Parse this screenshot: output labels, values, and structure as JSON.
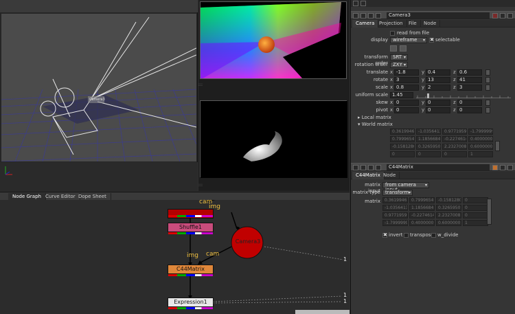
{
  "node_graph": {
    "tabs": [
      {
        "label": "Node Graph",
        "active": true
      },
      {
        "label": "Curve Editor",
        "active": false
      },
      {
        "label": "Dope Sheet",
        "active": false
      }
    ],
    "nodes": {
      "shuffle": "Shuffle1",
      "c44": "C44Matrix",
      "camera": "Camera3",
      "expression": "Expression1"
    },
    "labels": {
      "cam_top": "cam",
      "img_top": "img",
      "img": "img",
      "cam": "cam",
      "one_a": "1",
      "one_b": "1",
      "one_c": "1"
    }
  },
  "viewer3d": {
    "camera_label": "Camera3"
  },
  "camera_panel": {
    "node_name": "Camera3",
    "tabs": [
      {
        "label": "Camera",
        "active": true
      },
      {
        "label": "Projection",
        "active": false
      },
      {
        "label": "File",
        "active": false
      },
      {
        "label": "Node",
        "active": false
      }
    ],
    "read_from_file": "read from file",
    "display_label": "display",
    "display_value": "wireframe",
    "selectable": "selectable",
    "transform_order_label": "transform order",
    "transform_order": "SRT",
    "rotation_order_label": "rotation order",
    "rotation_order": "ZXY",
    "axes": {
      "x": "x",
      "y": "y",
      "z": "z"
    },
    "translate": {
      "label": "translate",
      "x": "-1.8",
      "y": "0.4",
      "z": "0.6"
    },
    "rotate": {
      "label": "rotate",
      "x": "3",
      "y": "13",
      "z": "41"
    },
    "scale": {
      "label": "scale",
      "x": "0.8",
      "y": "2",
      "z": "3"
    },
    "uniform_scale": {
      "label": "uniform scale",
      "value": "1.45"
    },
    "skew": {
      "label": "skew",
      "x": "0",
      "y": "0",
      "z": "0"
    },
    "pivot": {
      "label": "pivot",
      "x": "0",
      "y": "0",
      "z": "0"
    },
    "local_matrix": "Local matrix",
    "world_matrix": "World matrix",
    "world_matrix_values": [
      [
        "0.36199467",
        "-1.0356413",
        "0.97719599",
        "-1.7999999"
      ],
      [
        "0.79996546",
        "1.18566845",
        "-0.2274614",
        "0.40000001"
      ],
      [
        "-0.1581280",
        "0.32659507",
        "2.23270082",
        "0.60000002"
      ],
      [
        "0",
        "0",
        "0",
        "1"
      ]
    ]
  },
  "c44_panel": {
    "node_name": "C44Matrix",
    "tabs": [
      {
        "label": "C44Matrix",
        "active": true
      },
      {
        "label": "Node",
        "active": false
      }
    ],
    "matrix_input_label": "matrix input",
    "matrix_input": "from camera input",
    "matrix_type_label": "matrix type",
    "matrix_type": "transform",
    "matrix_label": "matrix",
    "matrix_values": [
      [
        "0.36199467",
        "0.79996546",
        "-0.1581280",
        "0"
      ],
      [
        "-1.0356413",
        "1.18566845",
        "0.32659507",
        "0"
      ],
      [
        "0.97719599",
        "-0.2274614",
        "2.23270082",
        "0"
      ],
      [
        "-1.7999999",
        "0.40000001",
        "0.60000002",
        "1"
      ]
    ],
    "invert": "invert",
    "transpose": "transpose",
    "w_divide": "w_divide"
  },
  "colors": {
    "shuffle_node": "#c94c7c",
    "c44_node": "#e0873a",
    "camera_node": "#c00000",
    "expression_node": "#e8e8e8",
    "read_node": "#b30000",
    "label_yellow": "#f0c040"
  }
}
